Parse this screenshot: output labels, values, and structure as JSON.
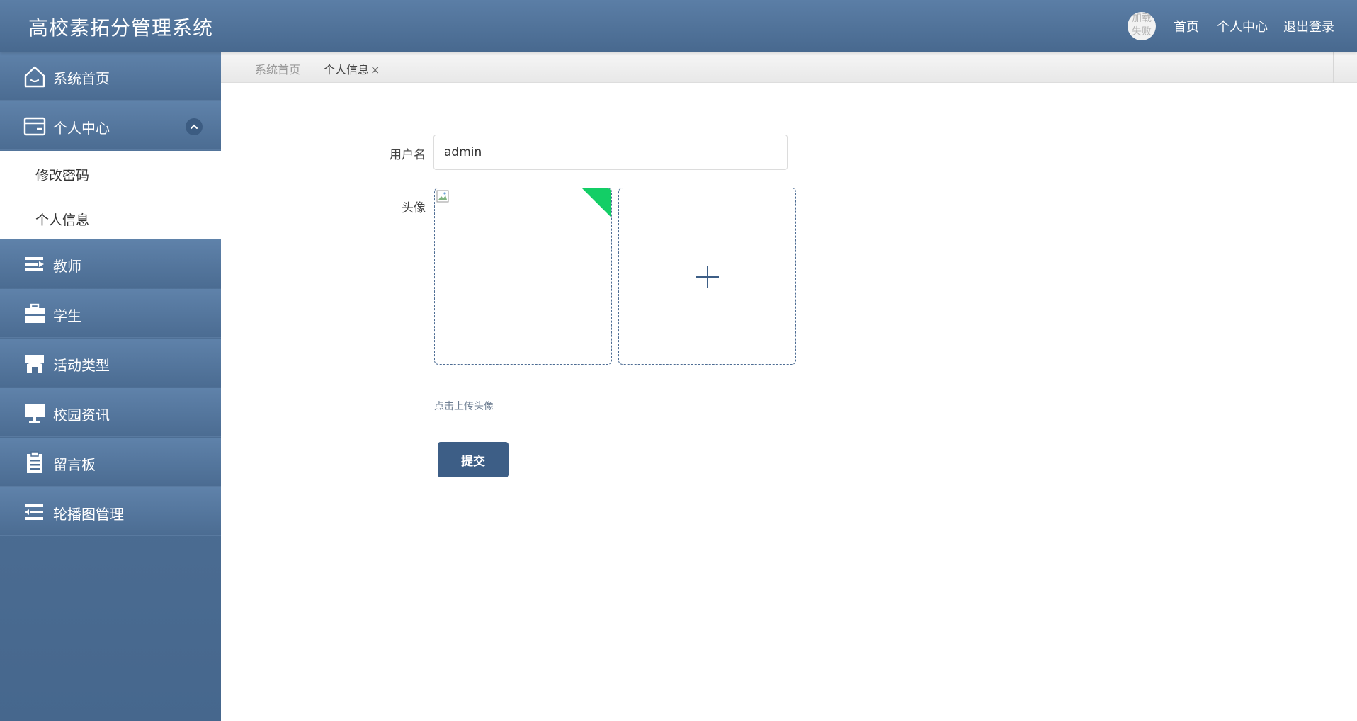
{
  "header": {
    "title": "高校素拓分管理系统",
    "avatar_text": "加载失败",
    "nav": {
      "home": "首页",
      "personal_center": "个人中心",
      "logout": "退出登录"
    }
  },
  "sidebar": {
    "items": [
      {
        "label": "系统首页",
        "icon": "home-icon"
      },
      {
        "label": "个人中心",
        "icon": "wallet-icon",
        "expanded": true,
        "children": [
          {
            "label": "修改密码"
          },
          {
            "label": "个人信息"
          }
        ]
      },
      {
        "label": "教师",
        "icon": "list-icon"
      },
      {
        "label": "学生",
        "icon": "briefcase-icon"
      },
      {
        "label": "活动类型",
        "icon": "store-icon"
      },
      {
        "label": "校园资讯",
        "icon": "monitor-icon"
      },
      {
        "label": "留言板",
        "icon": "clipboard-icon"
      },
      {
        "label": "轮播图管理",
        "icon": "list-indent-icon"
      }
    ]
  },
  "tabs": [
    {
      "label": "系统首页",
      "active": false
    },
    {
      "label": "个人信息",
      "active": true,
      "close": "×"
    }
  ],
  "form": {
    "username_label": "用户名",
    "username_value": "admin",
    "avatar_label": "头像",
    "upload_tip": "点击上传头像",
    "submit_label": "提交"
  },
  "colors": {
    "header": "#4f729a",
    "sidebar": "#4e6f95",
    "accent": "#3d5e86",
    "success": "#13ce66"
  }
}
